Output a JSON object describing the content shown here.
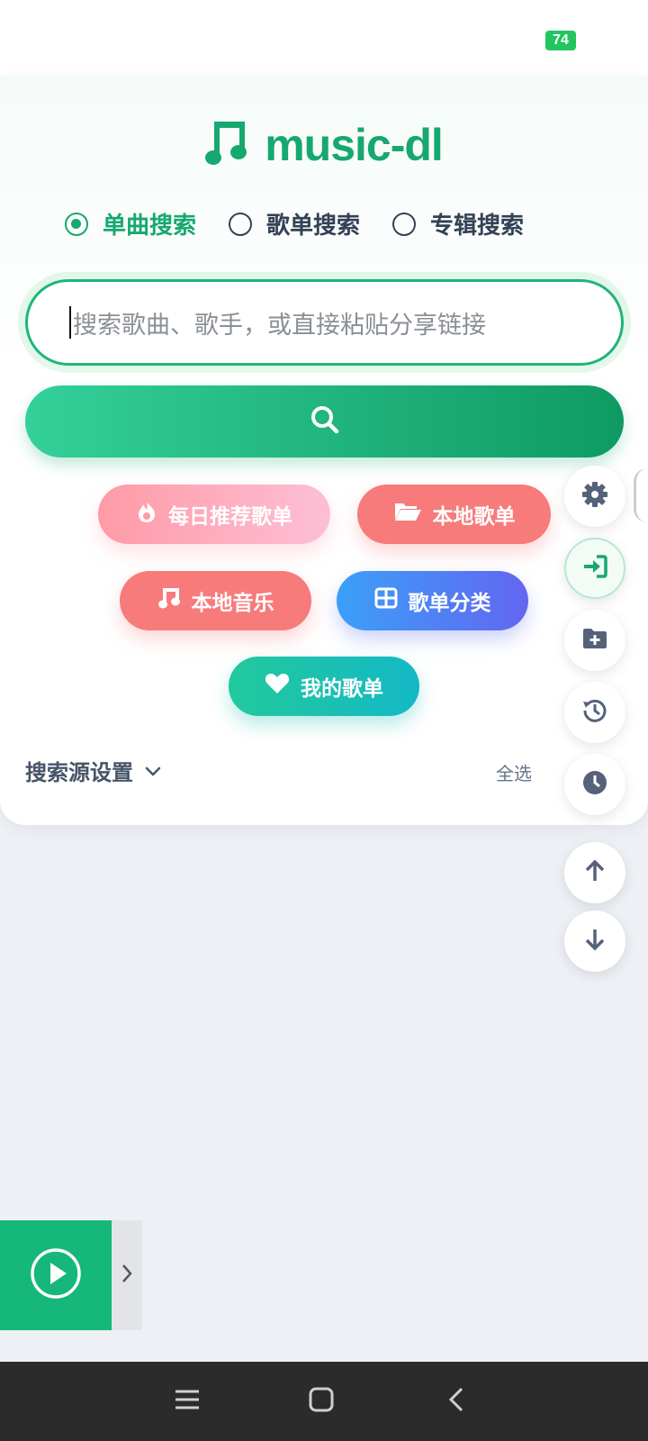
{
  "status_bar": {
    "battery": "74"
  },
  "header": {
    "app_title": "music-dl"
  },
  "search_modes": [
    {
      "label": "单曲搜索",
      "selected": true
    },
    {
      "label": "歌单搜索",
      "selected": false
    },
    {
      "label": "专辑搜索",
      "selected": false
    }
  ],
  "search": {
    "placeholder": "搜索歌曲、歌手，或直接粘贴分享链接",
    "button_icon": "search-icon"
  },
  "quick_actions": {
    "daily": {
      "label": "每日推荐歌单",
      "icon": "fire-icon"
    },
    "local_playlists": {
      "label": "本地歌单",
      "icon": "folder-open-icon"
    },
    "local_music": {
      "label": "本地音乐",
      "icon": "music-note-icon"
    },
    "categories": {
      "label": "歌单分类",
      "icon": "grid-icon"
    },
    "my_playlists": {
      "label": "我的歌单",
      "icon": "heart-icon"
    }
  },
  "source_settings": {
    "label": "搜索源设置",
    "select_all": "全选"
  },
  "floating_actions": [
    "gear-icon",
    "login-icon",
    "folder-plus-icon",
    "history-icon",
    "clock-icon",
    "arrow-up-icon",
    "arrow-down-icon"
  ],
  "colors": {
    "brand": "#16a870",
    "chip_red": "#f77b7b",
    "chip_blue": "#3b9ff8",
    "player": "#16b77a"
  }
}
